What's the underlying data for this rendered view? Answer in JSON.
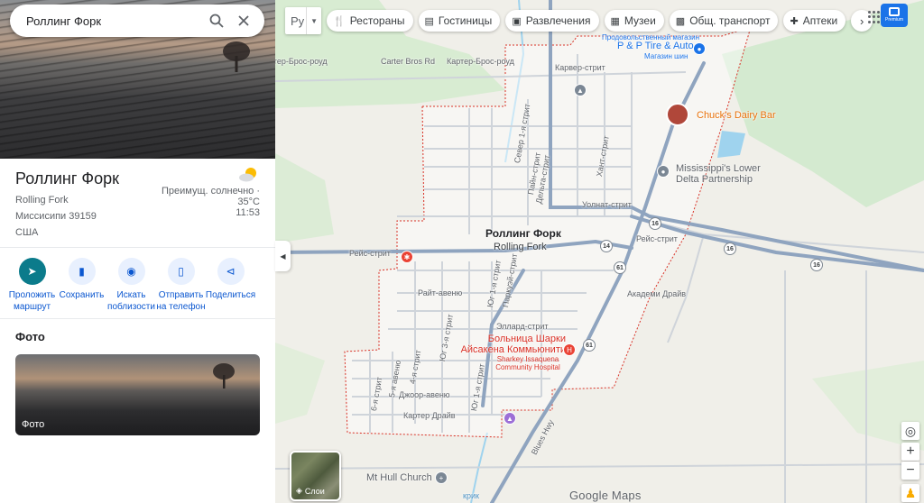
{
  "search": {
    "value": "Роллинг Форк"
  },
  "place": {
    "name": "Роллинг Форк",
    "address_lines": [
      "Rolling Fork",
      "Миссисипи 39159",
      "США"
    ]
  },
  "weather": {
    "condition": "Преимущ. солнечно ·",
    "temp": "35°C",
    "time": "11:53"
  },
  "actions": [
    {
      "label": "Проложить маршрут",
      "icon": "directions-icon"
    },
    {
      "label": "Сохранить",
      "icon": "bookmark-icon"
    },
    {
      "label": "Искать поблизости",
      "icon": "nearby-icon"
    },
    {
      "label": "Отправить на телефон",
      "icon": "send-to-phone-icon"
    },
    {
      "label": "Поделиться",
      "icon": "share-icon"
    }
  ],
  "photos": {
    "title": "Фото",
    "caption": "Фото"
  },
  "map": {
    "language": "Ру",
    "chips": [
      {
        "label": "Рестораны",
        "icon": "restaurant-icon"
      },
      {
        "label": "Гостиницы",
        "icon": "hotel-icon"
      },
      {
        "label": "Развлечения",
        "icon": "camera-icon"
      },
      {
        "label": "Музеи",
        "icon": "museum-icon"
      },
      {
        "label": "Общ. транспорт",
        "icon": "transit-icon"
      },
      {
        "label": "Аптеки",
        "icon": "pharmacy-icon"
      }
    ],
    "premium_label": "Premium",
    "layers_label": "Слои",
    "logo": "Google Maps",
    "town_label_ru": "Роллинг Форк",
    "town_label_en": "Rolling Fork",
    "streets": {
      "carter_bros": "Carter Bros Rd",
      "carter_bros_ru": "Картер-Брос-роуд",
      "carter_bros_ru_left": "ртер-Брос-роуд",
      "carver": "Карвер-стрит",
      "race": "Рейс-стрит",
      "race_east": "Рейс-стрит",
      "walnut": "Уолнат-стрит",
      "wright": "Райт-авеню",
      "ellard": "Эллард-стрит",
      "joor": "Джоор-авеню",
      "carter_dr": "Картер Драйв",
      "academy": "Академи Драйв",
      "main_n1": "Север 1-я стрит",
      "pine": "Пайн-стрит",
      "delta": "Дельта-стрит",
      "hunt": "Хант-стрит",
      "south1": "Юг 1-я стрит",
      "parkway": "Паркуэй-стрит",
      "south3": "Юг 3-я стрит",
      "fourth": "4-я стрит",
      "fifth": "5-я авеню",
      "sixth": "6-я стрит",
      "south1b": "Юг 1-я стрит",
      "blues_hwy": "Blues Hwy",
      "creek": "крик"
    },
    "pois": {
      "tire": "P & P Tire & Auto",
      "tire_sub": "Магазин шин",
      "tire_top": "Продовольственный магазин",
      "chucks": "Chuck's Dairy Bar",
      "delta": "Mississippi's Lower Delta Partnership",
      "hospital_ru": "Больница Шарки Айсакена Коммьюнити",
      "hospital_en": "Sharkey Issaquena Community Hospital",
      "church": "Mt Hull Church"
    },
    "route_shields": [
      "14",
      "16",
      "16",
      "16",
      "61",
      "61",
      "14"
    ]
  }
}
